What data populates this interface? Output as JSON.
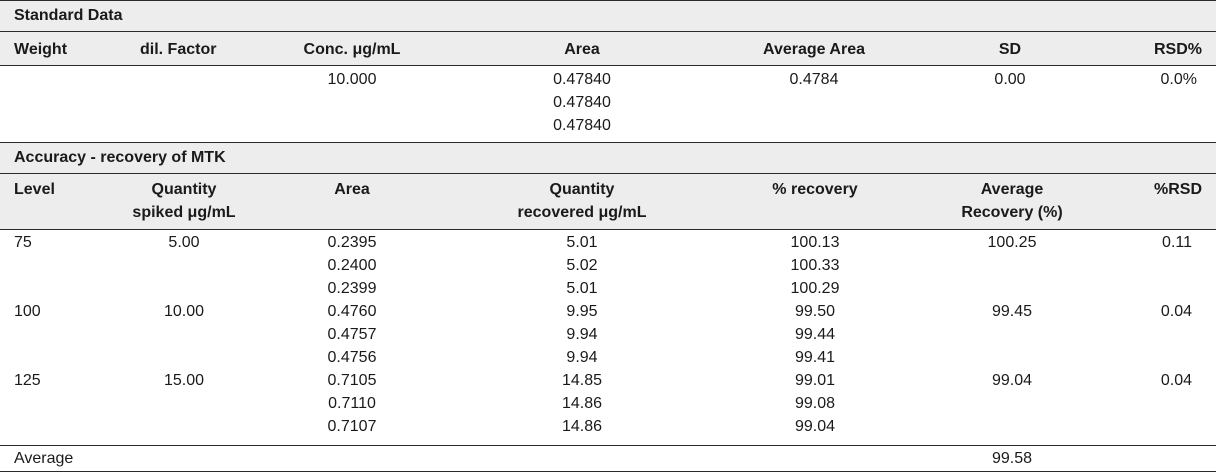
{
  "standard": {
    "title": "Standard Data",
    "headers": {
      "weight": "Weight",
      "dil_factor": "dil. Factor",
      "conc": "Conc. μg/mL",
      "area": "Area",
      "avg_area": "Average Area",
      "sd": "SD",
      "rsd": "RSD%"
    },
    "row": {
      "conc": "10.000",
      "areas": [
        "0.47840",
        "0.47840",
        "0.47840"
      ],
      "avg_area": "0.4784",
      "sd": "0.00",
      "rsd": "0.0%"
    }
  },
  "accuracy": {
    "title": "Accuracy - recovery of MTK",
    "headers": {
      "level": "Level",
      "qty_spiked_1": "Quantity",
      "qty_spiked_2": "spiked μg/mL",
      "area": "Area",
      "qty_recovered_1": "Quantity",
      "qty_recovered_2": "recovered μg/mL",
      "pct_recovery": "% recovery",
      "avg_recovery_1": "Average",
      "avg_recovery_2": "Recovery (%)",
      "pct_rsd": "%RSD"
    },
    "groups": [
      {
        "level": "75",
        "spiked": "5.00",
        "areas": [
          "0.2395",
          "0.2400",
          "0.2399"
        ],
        "recovered": [
          "5.01",
          "5.02",
          "5.01"
        ],
        "recovery": [
          "100.13",
          "100.33",
          "100.29"
        ],
        "avg_recovery": "100.25",
        "rsd": "0.11"
      },
      {
        "level": "100",
        "spiked": "10.00",
        "areas": [
          "0.4760",
          "0.4757",
          "0.4756"
        ],
        "recovered": [
          "9.95",
          "9.94",
          "9.94"
        ],
        "recovery": [
          "99.50",
          "99.44",
          "99.41"
        ],
        "avg_recovery": "99.45",
        "rsd": "0.04"
      },
      {
        "level": "125",
        "spiked": "15.00",
        "areas": [
          "0.7105",
          "0.7110",
          "0.7107"
        ],
        "recovered": [
          "14.85",
          "14.86",
          "14.86"
        ],
        "recovery": [
          "99.01",
          "99.08",
          "99.04"
        ],
        "avg_recovery": "99.04",
        "rsd": "0.04"
      }
    ],
    "average_label": "Average",
    "average_value": "99.58"
  }
}
